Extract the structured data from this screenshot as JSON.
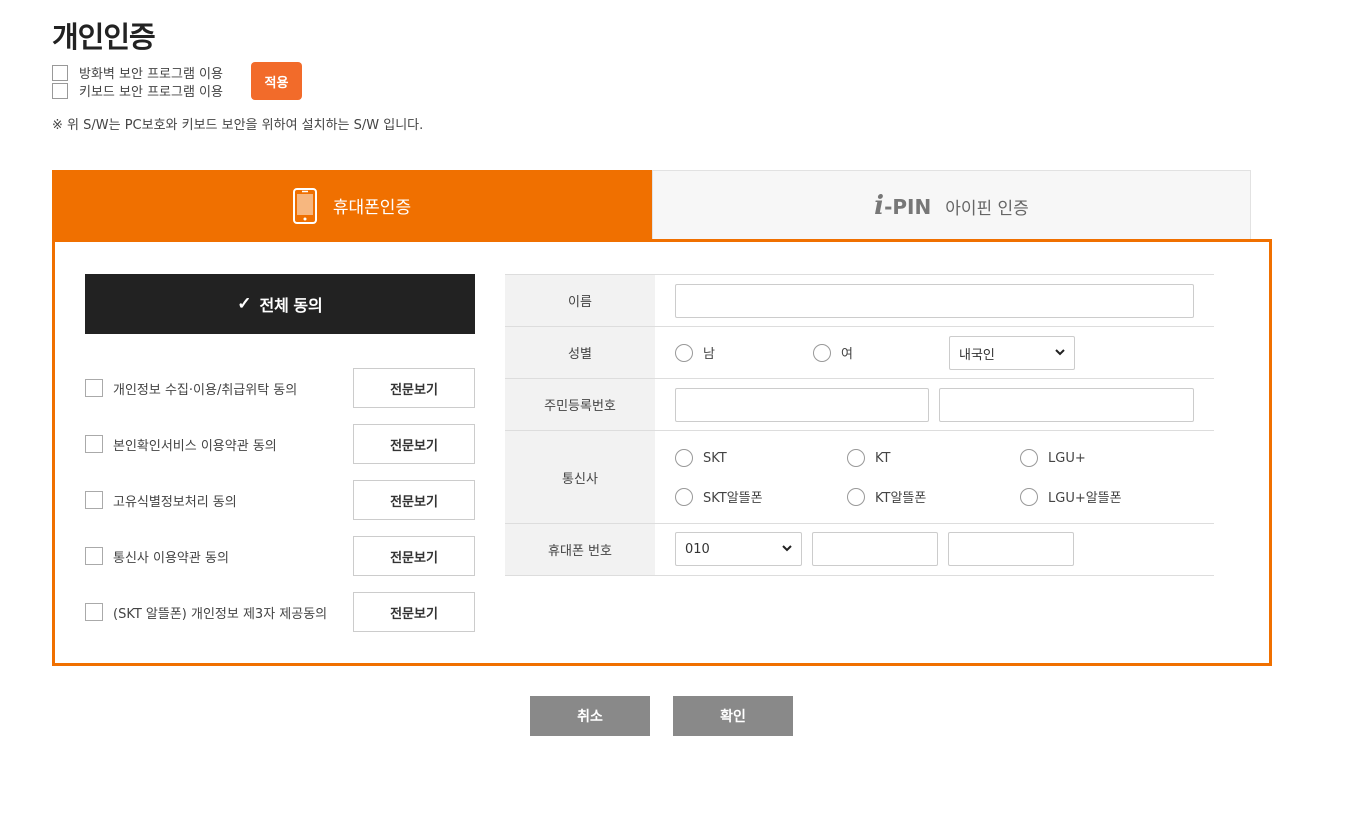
{
  "page_title": "개인인증",
  "security": {
    "firewall_label": "방화벽 보안 프로그램 이용",
    "keyboard_label": "키보드 보안 프로그램 이용",
    "apply_label": "적용",
    "notice": "※ 위 S/W는 PC보호와 키보드 보안을 위하여 설치하는 S/W 입니다."
  },
  "tabs": {
    "phone_label": "휴대폰인증",
    "ipin_logo_i": "i",
    "ipin_logo_pin": "-PIN",
    "ipin_label": "아이핀 인증"
  },
  "agree": {
    "all_check": "✓",
    "all_label": "전체 동의",
    "view_label": "전문보기",
    "items": [
      {
        "label": "개인정보 수집·이용/취급위탁 동의"
      },
      {
        "label": "본인확인서비스 이용약관 동의"
      },
      {
        "label": "고유식별정보처리 동의"
      },
      {
        "label": "통신사 이용약관 동의"
      },
      {
        "label": "(SKT 알뜰폰) 개인정보 제3자 제공동의"
      }
    ]
  },
  "form": {
    "name_label": "이름",
    "name_value": "",
    "gender_label": "성별",
    "gender_male": "남",
    "gender_female": "여",
    "nationality_selected": "내국인",
    "rrn_label": "주민등록번호",
    "rrn_front": "",
    "rrn_back": "",
    "carrier_label": "통신사",
    "carriers": [
      "SKT",
      "KT",
      "LGU+",
      "SKT알뜰폰",
      "KT알뜰폰",
      "LGU+알뜰폰"
    ],
    "phone_label": "휴대폰 번호",
    "phone_prefix_selected": "010",
    "phone_mid": "",
    "phone_last": ""
  },
  "buttons": {
    "cancel_label": "취소",
    "confirm_label": "확인"
  },
  "colors": {
    "accent": "#f07000",
    "apply_button": "#f26b2a",
    "dark_button": "#222222",
    "gray_button": "#898989"
  }
}
